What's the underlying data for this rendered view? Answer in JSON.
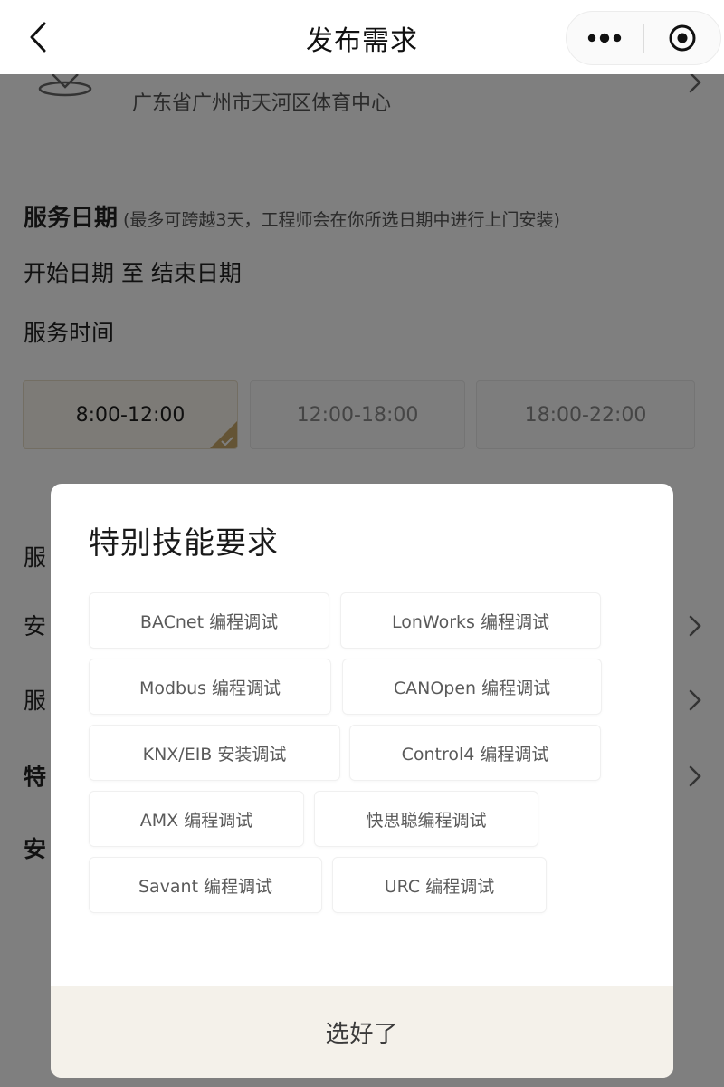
{
  "navbar": {
    "title": "发布需求"
  },
  "location": {
    "address": "广东省广州市天河区体育中心"
  },
  "service_date": {
    "title": "服务日期",
    "note": "(最多可跨越3天，工程师会在你所选日期中进行上门安装)",
    "range": "开始日期 至 结束日期"
  },
  "service_time": {
    "title": "服务时间",
    "slots": [
      {
        "label": "8:00-12:00",
        "selected": true
      },
      {
        "label": "12:00-18:00",
        "selected": false
      },
      {
        "label": "18:00-22:00",
        "selected": false
      }
    ]
  },
  "hidden_rows": {
    "row1": "服",
    "row2": "安",
    "row3": "服",
    "row4": "特",
    "row5": "安"
  },
  "modal": {
    "title": "特别技能要求",
    "skills": [
      "BACnet 编程调试",
      "LonWorks 编程调试",
      "Modbus 编程调试",
      "CANOpen 编程调试",
      "KNX/EIB 安装调试",
      "Control4 编程调试",
      "AMX 编程调试",
      "快思聪编程调试",
      "Savant 编程调试",
      "URC 编程调试"
    ],
    "confirm_label": "选好了"
  },
  "colors": {
    "accent": "#c9a96a",
    "selected_bg": "#fbf7ee",
    "footer_bg": "#f4f1ea"
  }
}
